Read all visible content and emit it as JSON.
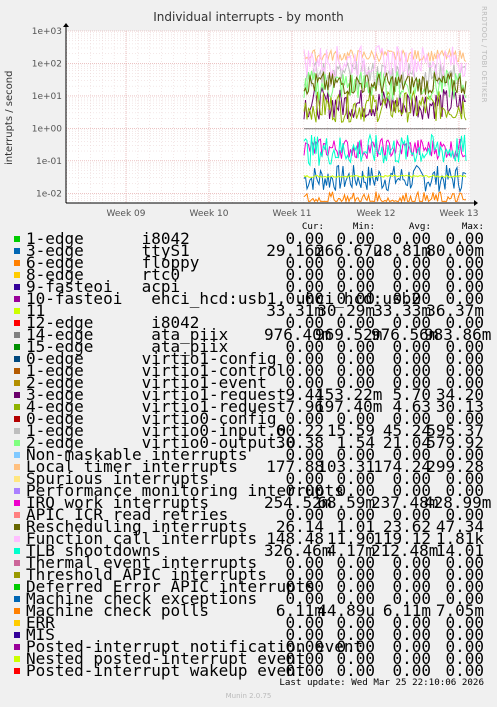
{
  "watermark": "RRDTOOL / TOBI OETIKER",
  "footer": {
    "last_update": "Last update: Wed Mar 25 22:10:06 2026",
    "munin_version": "Munin 2.0.75"
  },
  "table_headers": {
    "cur": "Cur:",
    "min": "Min:",
    "avg": "Avg:",
    "max": "Max:"
  },
  "chart_data": {
    "type": "line",
    "title": "Individual interrupts - by month",
    "ylabel": "interrupts / second",
    "yscale": "log",
    "ylim": [
      0.005,
      1000
    ],
    "y_ticks": [
      "1e-02",
      "1e-01",
      "1e+00",
      "1e+01",
      "1e+02",
      "1e+03"
    ],
    "x_ticks": [
      "Week 09",
      "Week 10",
      "Week 11",
      "Week 12",
      "Week 13"
    ],
    "grid": true,
    "series": [
      {
        "name": "1-edge      i8042",
        "color": "#00cc00",
        "cur": "0.00",
        "min": "0.00",
        "avg": "0.00",
        "max": "0.00"
      },
      {
        "name": "3-edge      ttyS1",
        "color": "#0066b3",
        "cur": "29.16m",
        "min": "266.67u",
        "avg": "28.81m",
        "max": "80.00m"
      },
      {
        "name": "6-edge      floppy",
        "color": "#ff8000",
        "cur": "0.00",
        "min": "0.00",
        "avg": "0.00",
        "max": "0.00"
      },
      {
        "name": "8-edge      rtc0",
        "color": "#ffcc00",
        "cur": "0.00",
        "min": "0.00",
        "avg": "0.00",
        "max": "0.00"
      },
      {
        "name": "9-fasteoi   acpi",
        "color": "#330099",
        "cur": "0.00",
        "min": "0.00",
        "avg": "0.00",
        "max": "0.00"
      },
      {
        "name": "10-fasteoi   ehci_hcd:usb1, uhci_hcd:usb2",
        "color": "#990099",
        "cur": "0.00",
        "min": "0.00",
        "avg": "0.00",
        "max": "0.00"
      },
      {
        "name": "11",
        "color": "#ccff00",
        "cur": "33.31m",
        "min": "30.29m",
        "avg": "33.33m",
        "max": "36.37m"
      },
      {
        "name": "12-edge      i8042",
        "color": "#ff0000",
        "cur": "0.00",
        "min": "0.00",
        "avg": "0.00",
        "max": "0.00"
      },
      {
        "name": "14-edge      ata_piix",
        "color": "#808080",
        "cur": "976.40m",
        "min": "969.52m",
        "avg": "976.56m",
        "max": "983.86m"
      },
      {
        "name": "15-edge      ata_piix",
        "color": "#008f00",
        "cur": "0.00",
        "min": "0.00",
        "avg": "0.00",
        "max": "0.00"
      },
      {
        "name": "0-edge      virtio1-config",
        "color": "#00487d",
        "cur": "0.00",
        "min": "0.00",
        "avg": "0.00",
        "max": "0.00"
      },
      {
        "name": "1-edge      virtio1-control",
        "color": "#b35a00",
        "cur": "0.00",
        "min": "0.00",
        "avg": "0.00",
        "max": "0.00"
      },
      {
        "name": "2-edge      virtio1-event",
        "color": "#b38f00",
        "cur": "0.00",
        "min": "0.00",
        "avg": "0.00",
        "max": "0.00"
      },
      {
        "name": "3-edge      virtio1-request",
        "color": "#6b006b",
        "cur": "9.44",
        "min": "153.22m",
        "avg": "5.70",
        "max": "34.20"
      },
      {
        "name": "4-edge      virtio1-request",
        "color": "#8fb300",
        "cur": "7.96",
        "min": "197.40m",
        "avg": "4.63",
        "max": "30.13"
      },
      {
        "name": "0-edge      virtio0-config",
        "color": "#b30000",
        "cur": "0.00",
        "min": "0.00",
        "avg": "0.00",
        "max": "0.00"
      },
      {
        "name": "1-edge      virtio0-input.0",
        "color": "#bebebe",
        "cur": "60.22",
        "min": "15.59",
        "avg": "45.24",
        "max": "595.37"
      },
      {
        "name": "2-edge      virtio0-output.0",
        "color": "#80ff80",
        "cur": "30.38",
        "min": "1.54",
        "avg": "21.04",
        "max": "579.92"
      },
      {
        "name": "Non-maskable interrupts",
        "color": "#80c9ff",
        "cur": "0.00",
        "min": "0.00",
        "avg": "0.00",
        "max": "0.00"
      },
      {
        "name": "Local timer interrupts",
        "color": "#ffc080",
        "cur": "177.88",
        "min": "103.31",
        "avg": "174.24",
        "max": "299.28"
      },
      {
        "name": "Spurious interrupts",
        "color": "#ffe680",
        "cur": "0.00",
        "min": "0.00",
        "avg": "0.00",
        "max": "0.00"
      },
      {
        "name": "Performance monitoring interrupts",
        "color": "#aa80ff",
        "cur": "0.00",
        "min": "0.00",
        "avg": "0.00",
        "max": "0.00"
      },
      {
        "name": "IRQ work interrupts",
        "color": "#ee00cc",
        "cur": "254.52m",
        "min": "68.59m",
        "avg": "237.48m",
        "max": "428.99m"
      },
      {
        "name": "APIC ICR read retries",
        "color": "#ff8080",
        "cur": "0.00",
        "min": "0.00",
        "avg": "0.00",
        "max": "0.00"
      },
      {
        "name": "Rescheduling interrupts",
        "color": "#666600",
        "cur": "26.14",
        "min": "1.01",
        "avg": "23.62",
        "max": "47.34"
      },
      {
        "name": "Function call interrupts",
        "color": "#ffbfff",
        "cur": "148.48",
        "min": "11.90",
        "avg": "119.12",
        "max": "1.81k"
      },
      {
        "name": "TLB shootdowns",
        "color": "#00ffcc",
        "cur": "326.46m",
        "min": "4.17m",
        "avg": "212.48m",
        "max": "14.01"
      },
      {
        "name": "Thermal event interrupts",
        "color": "#cc6699",
        "cur": "0.00",
        "min": "0.00",
        "avg": "0.00",
        "max": "0.00"
      },
      {
        "name": "Threshold APIC interrupts",
        "color": "#999900",
        "cur": "0.00",
        "min": "0.00",
        "avg": "0.00",
        "max": "0.00"
      },
      {
        "name": "Deferred Error APIC interrupts",
        "color": "#00cc00",
        "cur": "0.00",
        "min": "0.00",
        "avg": "0.00",
        "max": "0.00"
      },
      {
        "name": "Machine check exceptions",
        "color": "#0066b3",
        "cur": "0.00",
        "min": "0.00",
        "avg": "0.00",
        "max": "0.00"
      },
      {
        "name": "Machine check polls",
        "color": "#ff8000",
        "cur": "6.11m",
        "min": "44.89u",
        "avg": "6.11m",
        "max": "7.05m"
      },
      {
        "name": "ERR",
        "color": "#ffcc00",
        "cur": "0.00",
        "min": "0.00",
        "avg": "0.00",
        "max": "0.00"
      },
      {
        "name": "MIS",
        "color": "#330099",
        "cur": "0.00",
        "min": "0.00",
        "avg": "0.00",
        "max": "0.00"
      },
      {
        "name": "Posted-interrupt notification event",
        "color": "#990099",
        "cur": "0.00",
        "min": "0.00",
        "avg": "0.00",
        "max": "0.00"
      },
      {
        "name": "Nested posted-interrupt event",
        "color": "#ccff00",
        "cur": "0.00",
        "min": "0.00",
        "avg": "0.00",
        "max": "0.00"
      },
      {
        "name": "Posted-interrupt wakeup event",
        "color": "#ff0000",
        "cur": "0.00",
        "min": "0.00",
        "avg": "0.00",
        "max": "0.00"
      }
    ]
  }
}
